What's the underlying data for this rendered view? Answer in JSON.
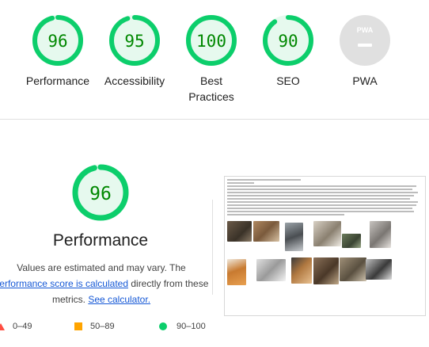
{
  "summary": {
    "categories": [
      {
        "id": "performance",
        "score": "96",
        "label": "Performance",
        "fraction": 0.96
      },
      {
        "id": "accessibility",
        "score": "95",
        "label": "Accessibility",
        "fraction": 0.95
      },
      {
        "id": "best-practices",
        "score": "100",
        "label": "Best Practices",
        "fraction": 1.0
      },
      {
        "id": "seo",
        "score": "90",
        "label": "SEO",
        "fraction": 0.9
      },
      {
        "id": "pwa",
        "score": "PWA",
        "label": "PWA"
      }
    ]
  },
  "performance": {
    "score": "96",
    "fraction": 0.96,
    "title": "Performance",
    "desc_prefix": "Values are estimated and may vary. The ",
    "desc_link1": "performance score is calculated",
    "desc_mid": " directly from these metrics. ",
    "desc_link2": "See calculator."
  },
  "legend": [
    {
      "range": "0–49",
      "color": "#ff4e42",
      "shape": "triangle"
    },
    {
      "range": "50–89",
      "color": "#ffa400",
      "shape": "square"
    },
    {
      "range": "90–100",
      "color": "#0cce6b",
      "shape": "circle"
    }
  ],
  "colors": {
    "pass": "#0cce6b",
    "pass_text": "#008800",
    "pass_bg": "#e6f9ee",
    "pwa_bg": "#e0e0e0",
    "link": "#1558d6"
  }
}
